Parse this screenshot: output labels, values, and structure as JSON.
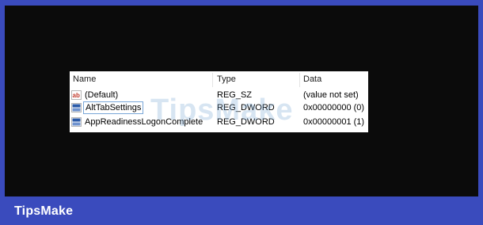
{
  "registry": {
    "columns": {
      "name": "Name",
      "type": "Type",
      "data": "Data"
    },
    "rows": [
      {
        "icon": "string-value-icon",
        "name": "(Default)",
        "type": "REG_SZ",
        "data": "(value not set)"
      },
      {
        "icon": "dword-value-icon",
        "name": "AltTabSettings",
        "type": "REG_DWORD",
        "data": "0x00000000 (0)"
      },
      {
        "icon": "dword-value-icon",
        "name": "AppReadinessLogonComplete",
        "type": "REG_DWORD",
        "data": "0x00000001 (1)"
      }
    ]
  },
  "watermark": "TipsMake",
  "brand": "TipsMake",
  "colors": {
    "frame": "#3a4bbd",
    "background": "#0b0b0b",
    "panel": "#ffffff",
    "edit_border": "#7aa7d8",
    "string_icon": "#c0392b",
    "dword_icon": "#2a5aa8"
  }
}
